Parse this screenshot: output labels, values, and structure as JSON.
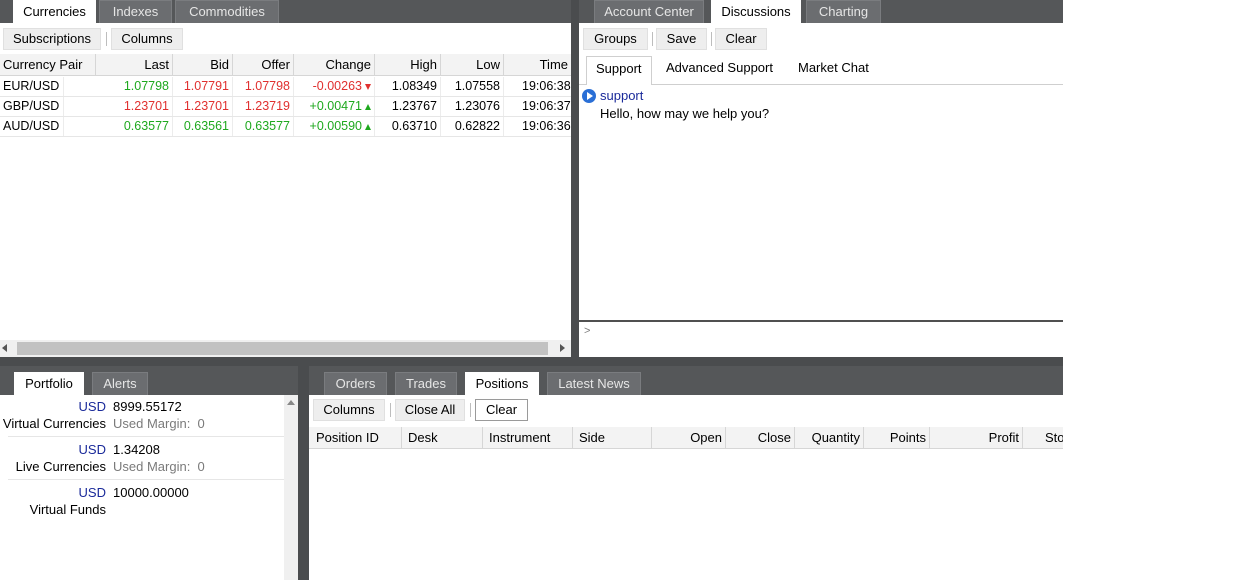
{
  "currencies_panel": {
    "tabs": [
      {
        "label": "Currencies",
        "active": true
      },
      {
        "label": "Indexes",
        "active": false
      },
      {
        "label": "Commodities",
        "active": false
      }
    ],
    "toolbar": {
      "subscriptions_label": "Subscriptions",
      "columns_label": "Columns"
    },
    "columns": [
      "Currency Pair",
      "Last",
      "Bid",
      "Offer",
      "Change",
      "High",
      "Low",
      "Time"
    ],
    "rows": [
      {
        "pair": "EUR/USD",
        "last": "1.07798",
        "bid": "1.07791",
        "offer": "1.07798",
        "change": "-0.00263",
        "high": "1.08349",
        "low": "1.07558",
        "time": "19:06:38"
      },
      {
        "pair": "GBP/USD",
        "last": "1.23701",
        "bid": "1.23701",
        "offer": "1.23719",
        "change": "+0.00471",
        "high": "1.23767",
        "low": "1.23076",
        "time": "19:06:37"
      },
      {
        "pair": "AUD/USD",
        "last": "0.63577",
        "bid": "0.63561",
        "offer": "0.63577",
        "change": "+0.00590",
        "high": "0.63710",
        "low": "0.62822",
        "time": "19:06:36"
      }
    ]
  },
  "discussions_panel": {
    "tabs": [
      {
        "label": "Account Center",
        "active": false
      },
      {
        "label": "Discussions",
        "active": true
      },
      {
        "label": "Charting",
        "active": false
      }
    ],
    "toolbar": {
      "groups_label": "Groups",
      "save_label": "Save",
      "clear_label": "Clear"
    },
    "channels": [
      "Support",
      "Advanced Support",
      "Market Chat"
    ],
    "message": {
      "sender": "support",
      "text": "Hello, how may we help you?"
    },
    "input_prompt": ">"
  },
  "portfolio_panel": {
    "tabs": [
      {
        "label": "Portfolio",
        "active": true
      },
      {
        "label": "Alerts",
        "active": false
      }
    ],
    "entries": [
      {
        "currency": "USD",
        "amount": "8999.55172",
        "label": "Virtual Currencies",
        "margin": "Used Margin:  0"
      },
      {
        "currency": "USD",
        "amount": "1.34208",
        "label": "Live Currencies",
        "margin": "Used Margin:  0"
      },
      {
        "currency": "USD",
        "amount": "10000.00000",
        "label": "Virtual Funds",
        "margin": ""
      }
    ]
  },
  "positions_panel": {
    "tabs": [
      {
        "label": "Orders",
        "active": false
      },
      {
        "label": "Trades",
        "active": false
      },
      {
        "label": "Positions",
        "active": true
      },
      {
        "label": "Latest News",
        "active": false
      }
    ],
    "toolbar": {
      "columns_label": "Columns",
      "close_all_label": "Close All",
      "clear_label": "Clear"
    },
    "columns": [
      "Position ID",
      "Desk",
      "Instrument",
      "Side",
      "Open",
      "Close",
      "Quantity",
      "Points",
      "Profit",
      "Sto"
    ]
  },
  "colors": {
    "dark_frame": "#555759",
    "up": "#1ea81e",
    "down": "#e0302f",
    "link_blue": "#1a2a9a"
  }
}
